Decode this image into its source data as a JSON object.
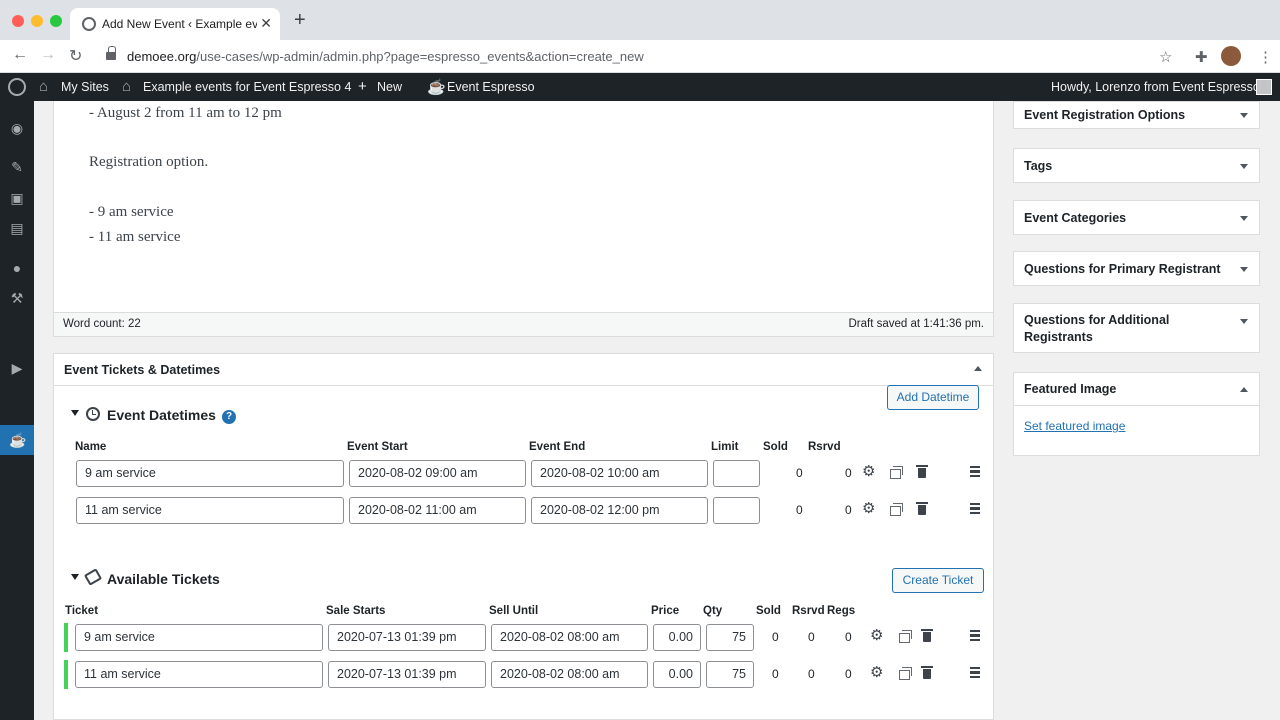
{
  "browser": {
    "tab_title": "Add New Event ‹ Example even",
    "url_host": "demoee.org",
    "url_path": "/use-cases/wp-admin/admin.php?page=espresso_events&action=create_new"
  },
  "adminbar": {
    "my_sites": "My Sites",
    "site_name": "Example events for Event Espresso 4",
    "new": "New",
    "event_espresso": "Event Espresso",
    "howdy": "Howdy, Lorenzo from Event Espresso"
  },
  "editor": {
    "lines": [
      "- August 2 from 11 am to 12 pm",
      "Registration option.",
      "- 9 am service",
      "- 11 am service"
    ],
    "word_count": "Word count: 22",
    "draft_saved": "Draft saved at 1:41:36 pm."
  },
  "tickets_panel": {
    "title": "Event Tickets & Datetimes",
    "add_datetime": "Add Datetime",
    "datetimes_title": "Event Datetimes",
    "help": "?",
    "datetime_columns": [
      "Name",
      "Event Start",
      "Event End",
      "Limit",
      "Sold",
      "Rsrvd"
    ],
    "datetimes": [
      {
        "name": "9 am service",
        "start": "2020-08-02 09:00 am",
        "end": "2020-08-02 10:00 am",
        "limit": "",
        "sold": "0",
        "rsrvd": "0"
      },
      {
        "name": "11 am service",
        "start": "2020-08-02 11:00 am",
        "end": "2020-08-02 12:00 pm",
        "limit": "",
        "sold": "0",
        "rsrvd": "0"
      }
    ],
    "tickets_title": "Available Tickets",
    "create_ticket": "Create Ticket",
    "ticket_columns": [
      "Ticket",
      "Sale Starts",
      "Sell Until",
      "Price",
      "Qty",
      "Sold",
      "Rsrvd",
      "Regs"
    ],
    "tickets": [
      {
        "name": "9 am service",
        "starts": "2020-07-13 01:39 pm",
        "until": "2020-08-02 08:00 am",
        "price": "0.00",
        "qty": "75",
        "sold": "0",
        "rsrvd": "0",
        "regs": "0"
      },
      {
        "name": "11 am service",
        "starts": "2020-07-13 01:39 pm",
        "until": "2020-08-02 08:00 am",
        "price": "0.00",
        "qty": "75",
        "sold": "0",
        "rsrvd": "0",
        "regs": "0"
      }
    ]
  },
  "sidebar": {
    "boxes": [
      "Event Registration Options",
      "Tags",
      "Event Categories",
      "Questions for Primary Registrant",
      "Questions for Additional Registrants"
    ],
    "featured_image": "Featured Image",
    "set_featured_image": "Set featured image"
  }
}
